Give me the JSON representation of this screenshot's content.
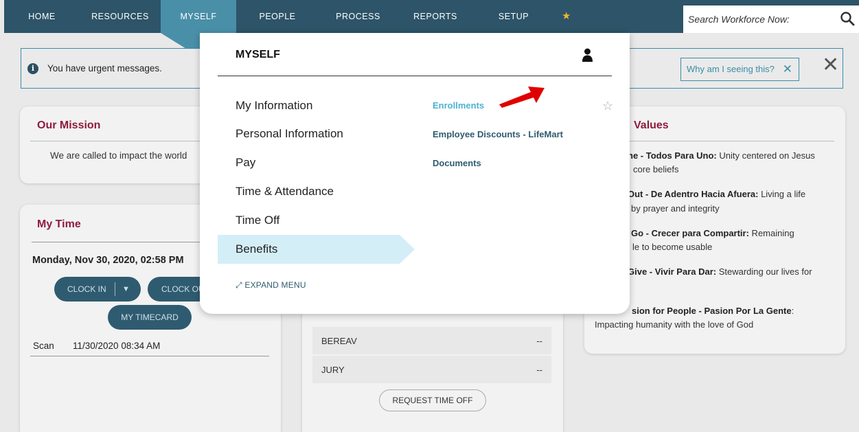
{
  "nav": {
    "items": [
      "HOME",
      "RESOURCES",
      "MYSELF",
      "PEOPLE",
      "PROCESS",
      "REPORTS",
      "SETUP"
    ],
    "active": "MYSELF",
    "search_placeholder": "Search Workforce Now:"
  },
  "alert": {
    "message": "You have urgent messages.",
    "why_label": "Why am I seeing this?"
  },
  "mission": {
    "title": "Our Mission",
    "text": "We are called to impact the world"
  },
  "mytime": {
    "title": "My Time",
    "datetime": "Monday, Nov 30, 2020, 02:58 PM",
    "clock_in": "CLOCK IN",
    "clock_out": "CLOCK OUT",
    "timecard": "MY TIMECARD",
    "punch": {
      "type": "Scan",
      "time": "11/30/2020 08:34 AM"
    }
  },
  "timeoff": {
    "rows": [
      {
        "label": "BEREAV",
        "value": "--"
      },
      {
        "label": "JURY",
        "value": "--"
      }
    ],
    "request_button": "REQUEST TIME OFF"
  },
  "values": {
    "title": "Values",
    "lines": [
      {
        "bold": "ne - Todos Para Uno:",
        "rest": " Unity centered on Jesus"
      },
      {
        "bold": "",
        "rest": "core beliefs"
      },
      {
        "bold": "Out - De Adentro Hacia Afuera:",
        "rest": " Living a life"
      },
      {
        "bold": "",
        "rest": "by prayer and integrity"
      },
      {
        "bold": "Go - Crecer para Compartir:",
        "rest": " Remaining"
      },
      {
        "bold": "",
        "rest": "le to become usable"
      },
      {
        "bold": "Give - Vivir Para Dar:",
        "rest": " Stewarding our lives for"
      },
      {
        "bold": "sion for People - Pasion Por La Gente",
        "rest": ":"
      },
      {
        "bold": "",
        "rest": "Impacting humanity with the love of God"
      }
    ]
  },
  "menu": {
    "title": "MYSELF",
    "left_items": [
      "My Information",
      "Personal Information",
      "Pay",
      "Time & Attendance",
      "Time Off",
      "Benefits"
    ],
    "selected": "Benefits",
    "right_items": [
      "Enrollments",
      "Employee Discounts - LifeMart",
      "Documents"
    ],
    "highlighted": "Enrollments",
    "expand_label": "EXPAND MENU"
  },
  "colors": {
    "nav_bg": "#2d5468",
    "nav_active": "#4a8fa8",
    "title_maroon": "#8e1b3d",
    "link_teal": "#2f5b70",
    "link_highlight": "#4bb4d1",
    "selected_bg": "#d4eef8",
    "annotation_red": "#e00000"
  }
}
